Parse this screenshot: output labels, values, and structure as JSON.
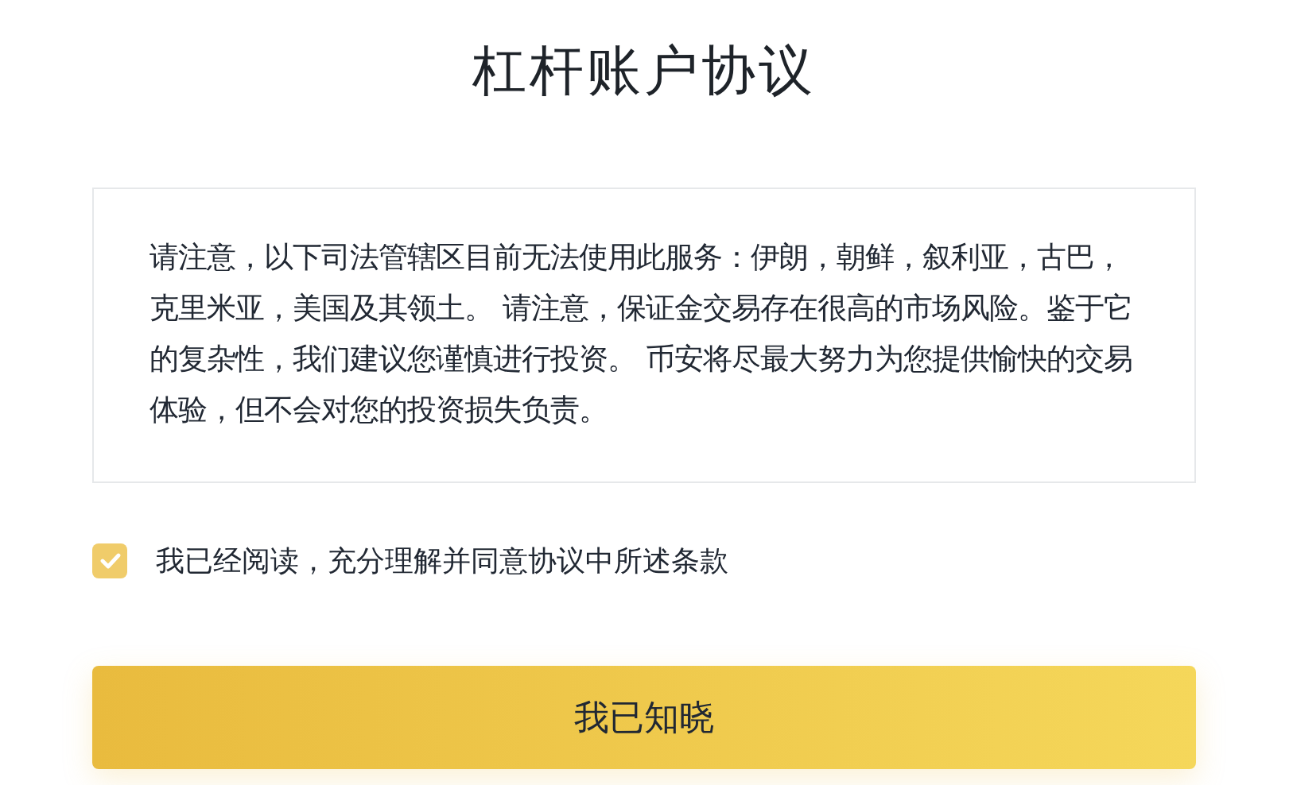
{
  "title": "杠杆账户协议",
  "notice": "请注意，以下司法管辖区目前无法使用此服务：伊朗，朝鲜，叙利亚，古巴，克里米亚，美国及其领土。 请注意，保证金交易存在很高的市场风险。鉴于它的复杂性，我们建议您谨慎进行投资。 币安将尽最大努力为您提供愉快的交易体验，但不会对您的投资损失负责。",
  "agreement": {
    "label": "我已经阅读，充分理解并同意协议中所述条款",
    "checked": true
  },
  "confirm_button": "我已知晓"
}
